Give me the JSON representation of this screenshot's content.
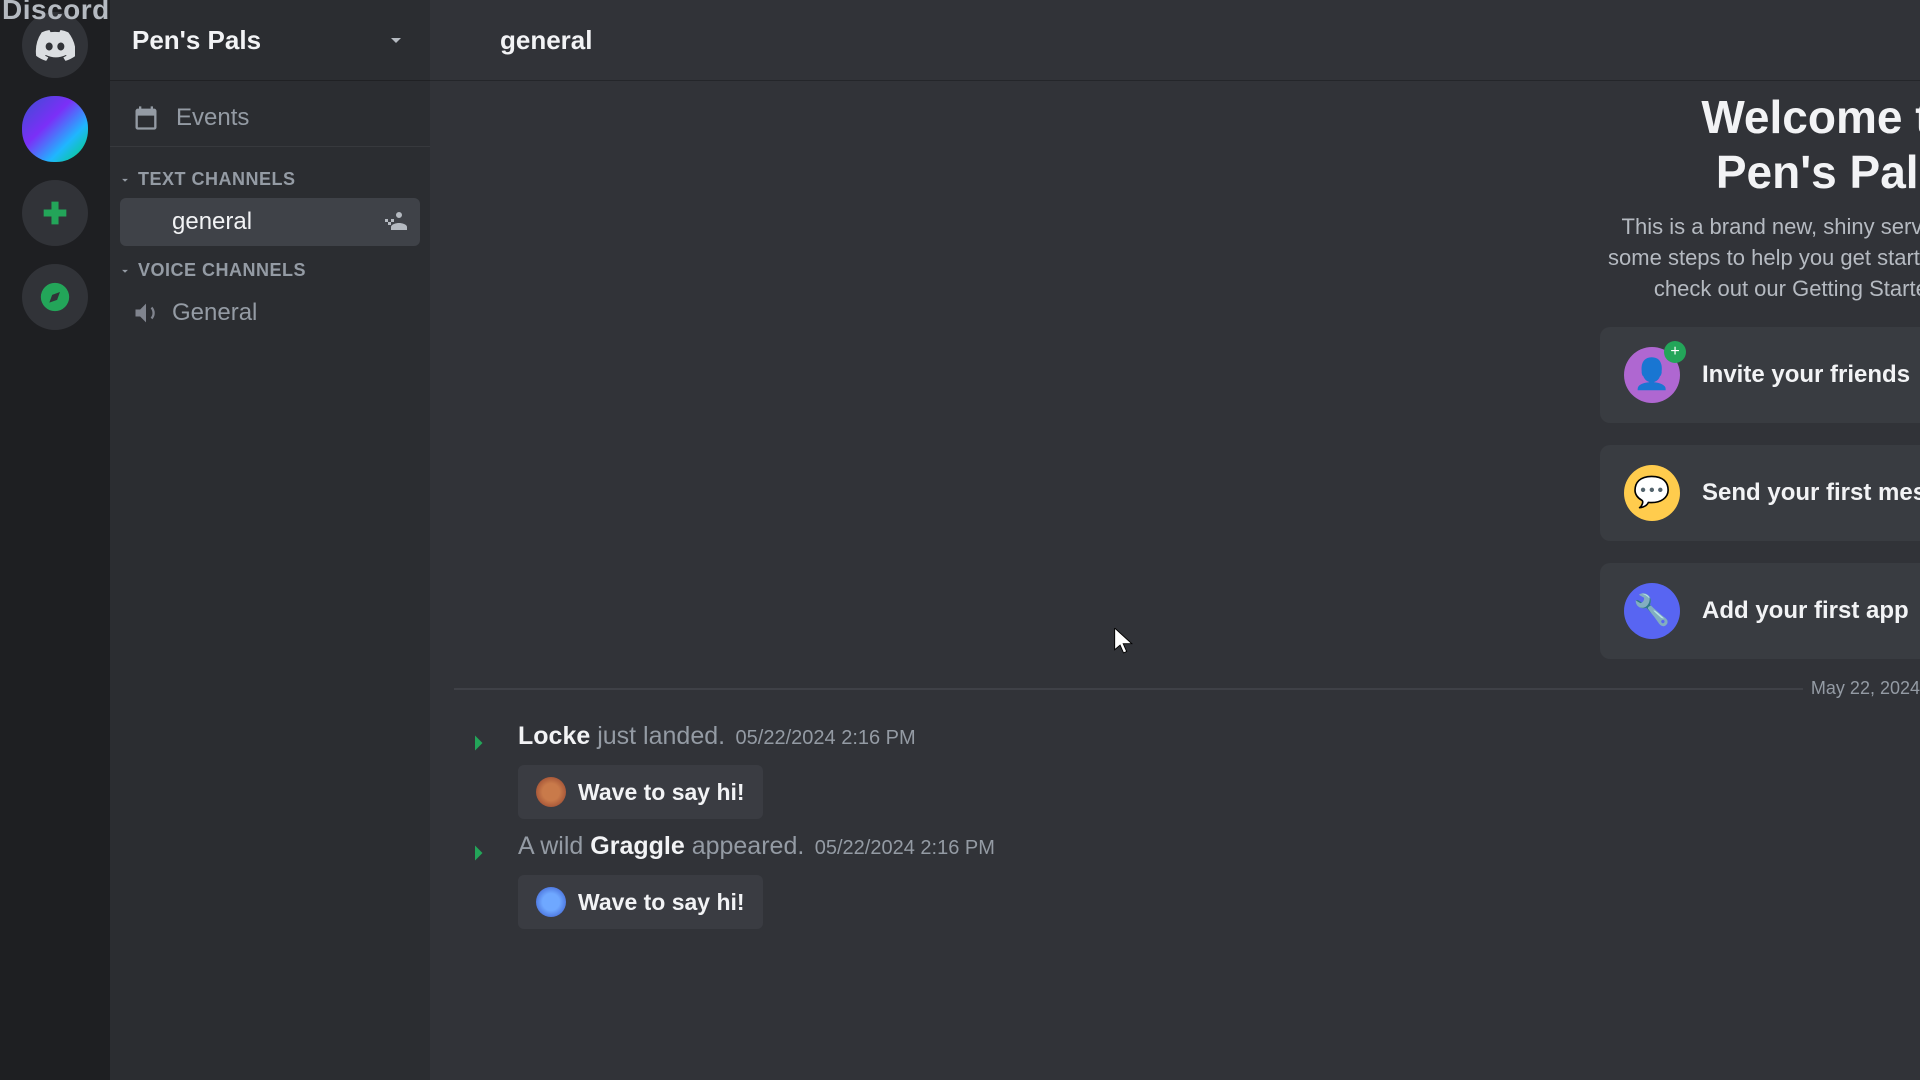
{
  "app_name": "Discord",
  "server": {
    "name": "Pen's Pals"
  },
  "rail": {
    "home_label": "Direct Messages",
    "server_label": "Pen's Pals",
    "add_label": "Add a Server",
    "discover_label": "Explore Discoverable Servers"
  },
  "sidebar": {
    "events_label": "Events",
    "categories": [
      {
        "label": "TEXT CHANNELS",
        "channels": [
          {
            "name": "general",
            "active": true
          }
        ]
      },
      {
        "label": "VOICE CHANNELS",
        "channels": [
          {
            "name": "General",
            "active": false
          }
        ]
      }
    ]
  },
  "topbar": {
    "channel": "general"
  },
  "welcome": {
    "title_line1": "Welcome to",
    "title_line2": "Pen's Pals",
    "subtitle": "This is a brand new, shiny server. Here are some steps to help you get started. For more, check out our Getting Started guide.",
    "cards": [
      {
        "label": "Invite your friends"
      },
      {
        "label": "Send your first message"
      },
      {
        "label": "Add your first app"
      }
    ]
  },
  "divider_date": "May 22, 2024",
  "messages": [
    {
      "arrow": "join",
      "prefix": "",
      "name": "Locke",
      "suffix": " just landed.",
      "timestamp": "05/22/2024 2:16 PM",
      "wave_label": "Wave to say hi!"
    },
    {
      "arrow": "join",
      "prefix": "A wild ",
      "name": "Graggle",
      "suffix": " appeared.",
      "timestamp": "05/22/2024 2:16 PM",
      "wave_label": "Wave to say hi!"
    }
  ]
}
